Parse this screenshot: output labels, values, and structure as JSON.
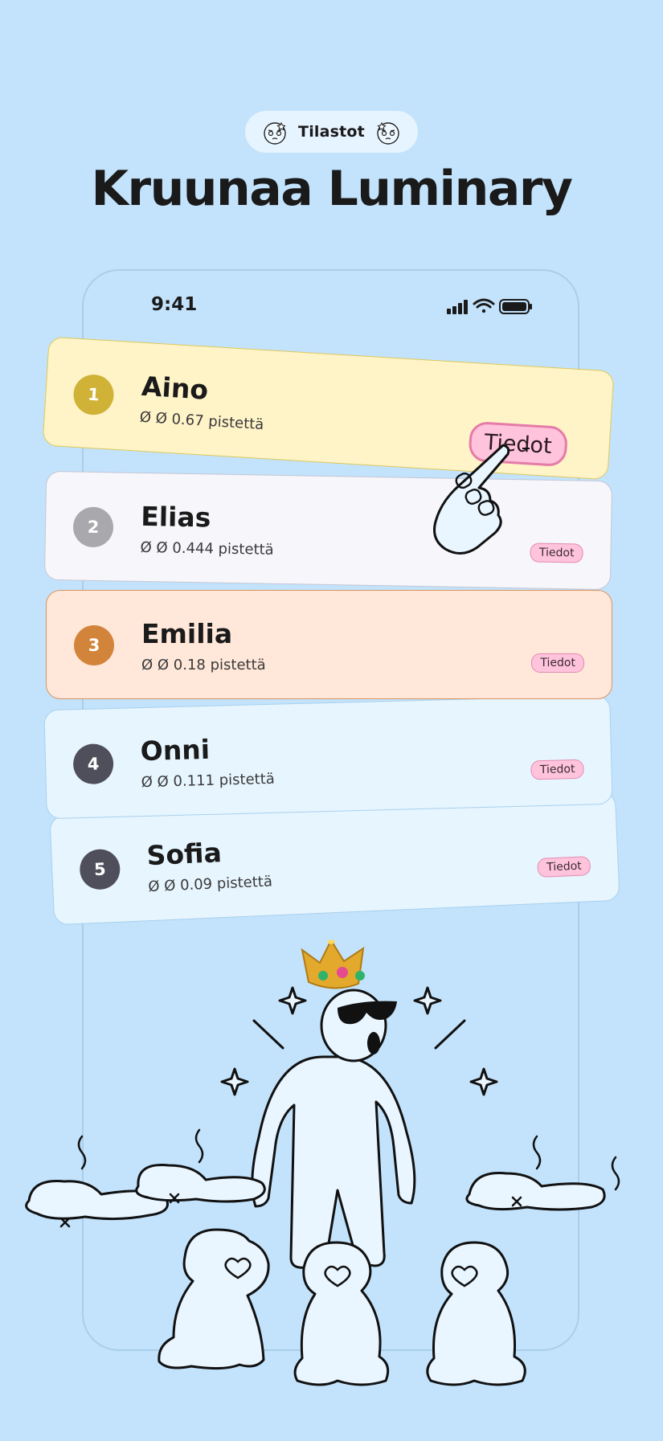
{
  "badge": {
    "label": "Tilastot"
  },
  "headline": "Kruunaa Luminary",
  "status_bar": {
    "time": "9:41"
  },
  "leaderboard": [
    {
      "rank": "1",
      "name": "Aino",
      "score": "Ø Ø 0.67 pistettä",
      "button": "Tiedot",
      "color": "#cfb236"
    },
    {
      "rank": "2",
      "name": "Elias",
      "score": "Ø Ø 0.444 pistettä",
      "button": "Tiedot",
      "color": "#a9a9ad"
    },
    {
      "rank": "3",
      "name": "Emilia",
      "score": "Ø Ø 0.18 pistettä",
      "button": "Tiedot",
      "color": "#d2853a"
    },
    {
      "rank": "4",
      "name": "Onni",
      "score": "Ø Ø 0.111 pistettä",
      "button": "Tiedot",
      "color": "#4f4f5c"
    },
    {
      "rank": "5",
      "name": "Sofia",
      "score": "Ø Ø 0.09 pistettä",
      "button": "Tiedot",
      "color": "#4f4f5c"
    }
  ],
  "icons": [
    "face-icon",
    "signal-icon",
    "wifi-icon",
    "battery-icon",
    "pointing-hand-icon",
    "crown-icon",
    "sunglasses-icon",
    "sparkle-icon",
    "heart-eyes-icon"
  ],
  "colors": {
    "background": "#c3e3fc",
    "accent_button": "#ffc4dc"
  }
}
